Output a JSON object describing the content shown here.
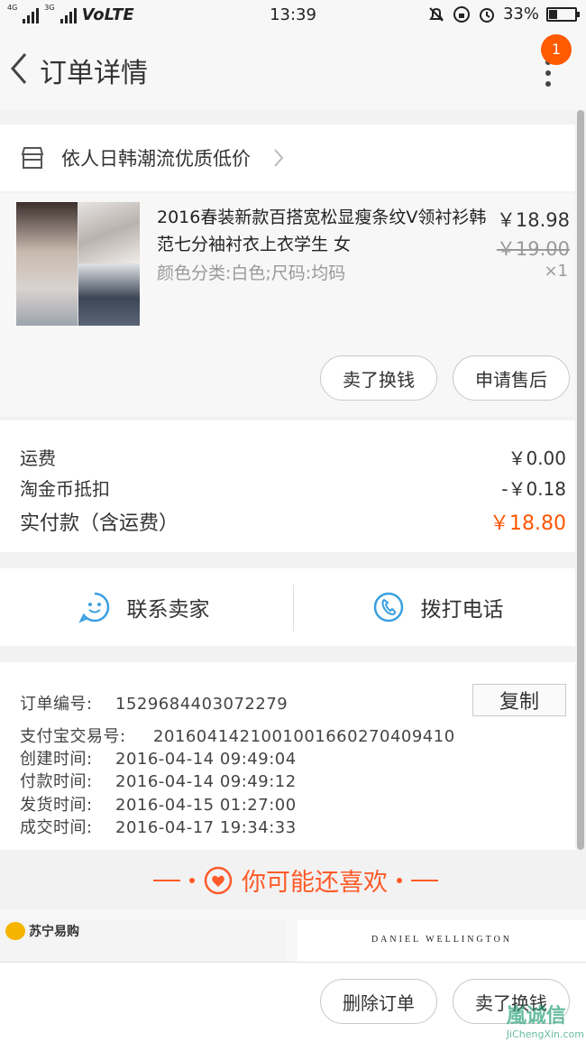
{
  "status": {
    "network1": "4G",
    "network2": "3G",
    "volte": "VoLTE",
    "time": "13:39",
    "battery_percent": "33%",
    "battery_level": 0.33
  },
  "nav": {
    "title": "订单详情",
    "badge": "1"
  },
  "shop": {
    "name": "依人日韩潮流优质低价"
  },
  "product": {
    "name": "2016春装新款百搭宽松显瘦条纹V领衬衫韩范七分袖衬衣上衣学生 女",
    "sku": "颜色分类:白色;尺码:均码",
    "price": "￥18.98",
    "original_price": "￥19.00",
    "quantity": "×1",
    "btn_sell": "卖了换钱",
    "btn_aftersale": "申请售后"
  },
  "fees": {
    "shipping_label": "运费",
    "shipping_value": "￥0.00",
    "coin_label": "淘金币抵扣",
    "coin_value": "-￥0.18",
    "total_label": "实付款（含运费）",
    "total_value": "￥18.80"
  },
  "contact": {
    "seller": "联系卖家",
    "phone": "拨打电话"
  },
  "order_info": {
    "order_no_label": "订单编号:",
    "order_no": "1529684403072279",
    "copy": "复制",
    "alipay_label": "支付宝交易号:",
    "alipay_no": "2016041421001001660270409410",
    "created_label": "创建时间:",
    "created": "2016-04-14 09:49:04",
    "paid_label": "付款时间:",
    "paid": "2016-04-14 09:49:12",
    "shipped_label": "发货时间:",
    "shipped": "2016-04-15 01:27:00",
    "done_label": "成交时间:",
    "done": "2016-04-17 19:34:33"
  },
  "recommend": {
    "title": "你可能还喜欢"
  },
  "ads": {
    "left_logo": "苏宁易购",
    "right_brand": "DANIEL WELLINGTON"
  },
  "bottom": {
    "delete": "删除订单",
    "sell": "卖了换钱"
  },
  "watermark": {
    "text": "嵐诚信",
    "url": "JiChengXin.com"
  },
  "colors": {
    "accent": "#ff5500",
    "badge": "#ff5a00",
    "contact_icon": "#3aa0e0"
  }
}
